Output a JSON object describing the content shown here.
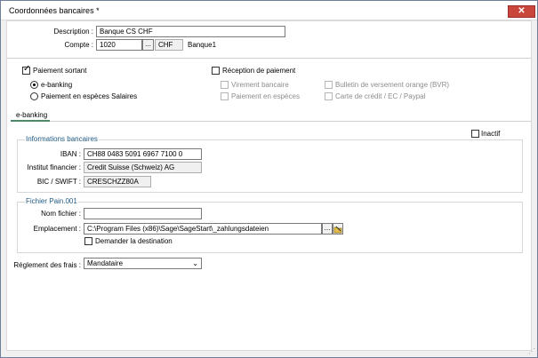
{
  "window": {
    "title": "Coordonnées bancaires *",
    "close_symbol": "✕"
  },
  "form": {
    "description_label": "Description :",
    "description_value": "Banque CS CHF",
    "compte_label": "Compte :",
    "compte_value": "1020",
    "browse_button": "...",
    "currency_value": "CHF",
    "account_name": "Banque1"
  },
  "payments": {
    "outgoing": {
      "label": "Paiement sortant",
      "checked": true
    },
    "ebanking": {
      "label": "e-banking",
      "selected": true
    },
    "cash_salary": {
      "label": "Paiement en espèces Salaires",
      "selected": false
    },
    "incoming": {
      "label": "Réception de paiement",
      "checked": false
    },
    "bank_transfer": {
      "label": "Virement bancaire"
    },
    "cash_payment": {
      "label": "Paiement en espèces"
    },
    "orange_slip": {
      "label": "Bulletin de versement orange (BVR)"
    },
    "credit_card": {
      "label": "Carte de crédit / EC / Paypal"
    }
  },
  "tab": {
    "label": "e-banking"
  },
  "inactive": {
    "label": "Inactif",
    "checked": false
  },
  "bank_info": {
    "title": "Informations bancaires",
    "iban_label": "IBAN :",
    "iban_value": "CH88 0483 5091 6967 7100 0",
    "institution_label": "Institut financier :",
    "institution_value": "Credit Suisse (Schweiz) AG",
    "bic_label": "BIC / SWIFT :",
    "bic_value": "CRESCHZZ80A"
  },
  "pain_file": {
    "title": "Fichier Pain.001",
    "filename_label": "Nom fichier :",
    "filename_value": "",
    "location_label": "Emplacement :",
    "location_value": "C:\\Program Files (x86)\\Sage\\SageStart\\_zahlungsdateien",
    "browse_button": "...",
    "ask_destination": {
      "label": "Demander la destination",
      "checked": false
    }
  },
  "fees": {
    "label": "Réglement des frais :",
    "value": "Mandataire"
  },
  "icons": {
    "close": "close-icon",
    "dropdown": "chevron-down-icon",
    "folder": "folder-icon"
  }
}
